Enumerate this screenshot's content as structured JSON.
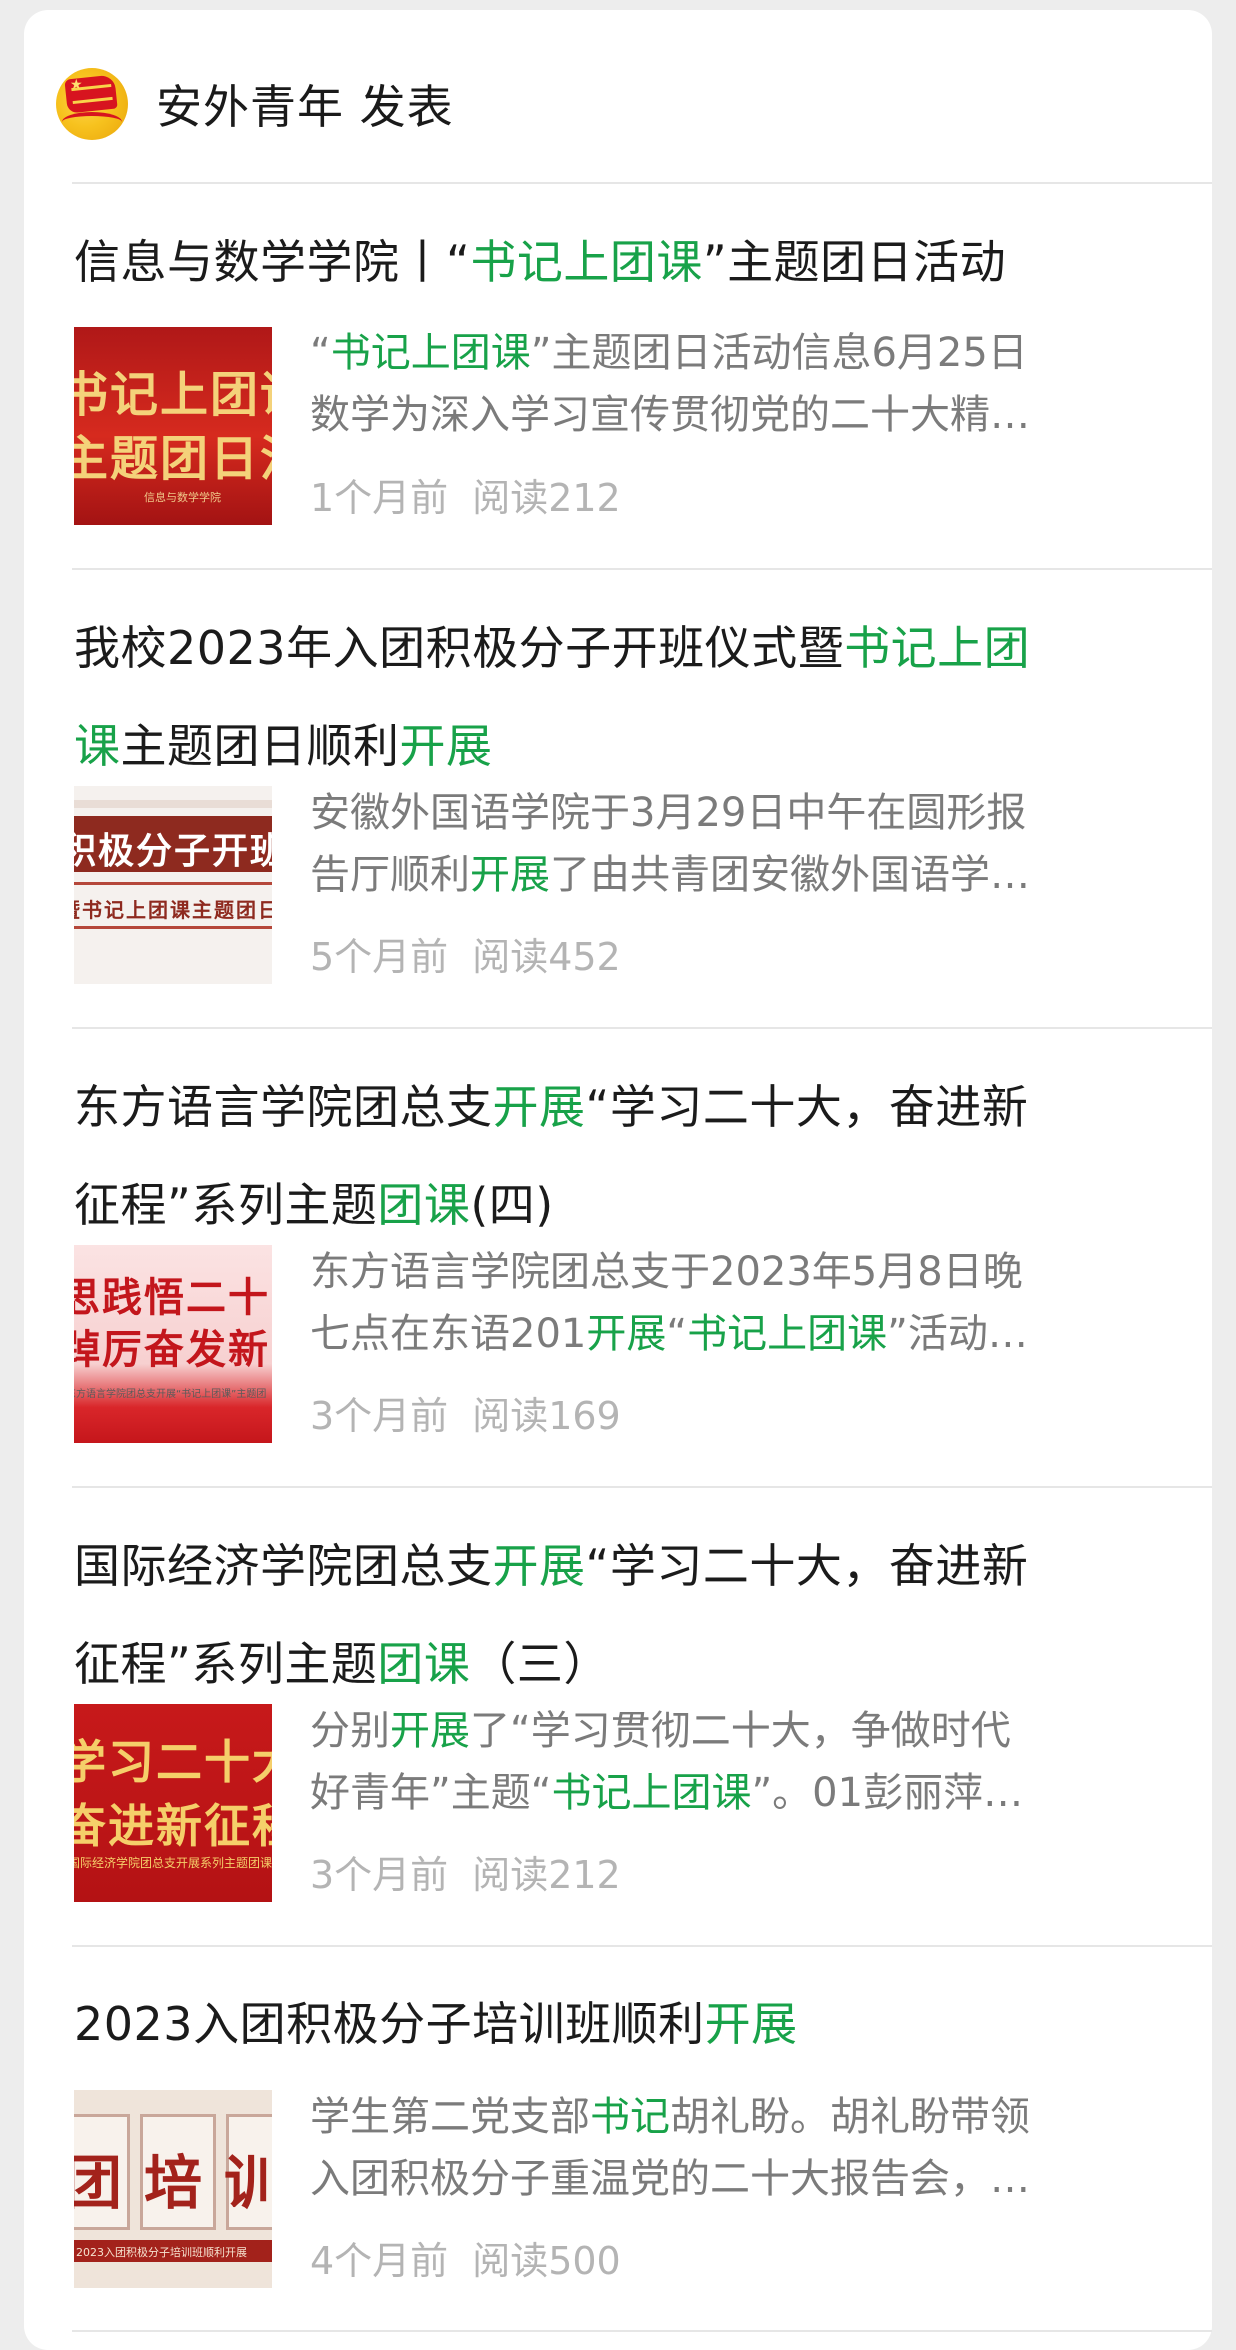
{
  "account": {
    "name": "安外青年 发表",
    "avatar_icon": "communist-youth-league-emblem-icon"
  },
  "colors": {
    "highlight": "#18a249",
    "title": "#1b1b1b",
    "summary": "#7b7b7b",
    "meta": "#b4b4b4"
  },
  "articles": [
    {
      "title_lines": [
        [
          {
            "t": "信息与数学学院丨“",
            "h": false
          },
          {
            "t": "书记上团课",
            "h": true
          },
          {
            "t": "”主题团日活动",
            "h": false
          }
        ]
      ],
      "summary_lines": [
        [
          {
            "t": "“",
            "h": false
          },
          {
            "t": "书记上团课",
            "h": true
          },
          {
            "t": "”主题团日活动信息6月25日",
            "h": false
          }
        ],
        [
          {
            "t": "数学为深入学习宣传贯彻党的二十大精…",
            "h": false
          }
        ]
      ],
      "time": "1个月前",
      "reads": "阅读212",
      "thumb": {
        "big1": "书记上团课",
        "big2": "主题团日活动",
        "small": "信息与数学学院",
        "icon": "article-thumbnail-red-banner"
      }
    },
    {
      "title_lines": [
        [
          {
            "t": "我校2023年入团积极分子开班仪式暨",
            "h": false
          },
          {
            "t": "书记上团",
            "h": true
          }
        ],
        [
          {
            "t": "课",
            "h": true
          },
          {
            "t": "主题团日顺利",
            "h": false
          },
          {
            "t": "开展",
            "h": true
          }
        ]
      ],
      "summary_lines": [
        [
          {
            "t": "安徽外国语学院于3月29日中午在圆形报",
            "h": false
          }
        ],
        [
          {
            "t": "告厅顺利",
            "h": false
          },
          {
            "t": "开展",
            "h": true
          },
          {
            "t": "了由共青团安徽外国语学…",
            "h": false
          }
        ]
      ],
      "time": "5个月前",
      "reads": "阅读452",
      "thumb": {
        "big1": "积极分子开班",
        "big2": "暨书记上团课主题团日",
        "small": "",
        "icon": "article-thumbnail-brown-banner"
      }
    },
    {
      "title_lines": [
        [
          {
            "t": "东方语言学院团总支",
            "h": false
          },
          {
            "t": "开展",
            "h": true
          },
          {
            "t": "“学习二十大，奋进新",
            "h": false
          }
        ],
        [
          {
            "t": "征程”系列主题",
            "h": false
          },
          {
            "t": "团课",
            "h": true
          },
          {
            "t": "(四)",
            "h": false
          }
        ]
      ],
      "summary_lines": [
        [
          {
            "t": "东方语言学院团总支于2023年5月8日晚",
            "h": false
          }
        ],
        [
          {
            "t": "七点在东语201",
            "h": false
          },
          {
            "t": "开展",
            "h": true
          },
          {
            "t": "“",
            "h": false
          },
          {
            "t": "书记上团课",
            "h": true
          },
          {
            "t": "”活动…",
            "h": false
          }
        ]
      ],
      "time": "3个月前",
      "reads": "阅读169",
      "thumb": {
        "big1": "思践悟二十",
        "big2": "踔厉奋发新时",
        "small": "东方语言学院团总支开展“书记上团课”主题团",
        "icon": "article-thumbnail-pink-banner"
      }
    },
    {
      "title_lines": [
        [
          {
            "t": "国际经济学院团总支",
            "h": false
          },
          {
            "t": "开展",
            "h": true
          },
          {
            "t": "“学习二十大，奋进新",
            "h": false
          }
        ],
        [
          {
            "t": "征程”系列主题",
            "h": false
          },
          {
            "t": "团课",
            "h": true
          },
          {
            "t": "（三）",
            "h": false
          }
        ]
      ],
      "summary_lines": [
        [
          {
            "t": "分别",
            "h": false
          },
          {
            "t": "开展",
            "h": true
          },
          {
            "t": "了“学习贯彻二十大，争做时代",
            "h": false
          }
        ],
        [
          {
            "t": "好青年”主题“",
            "h": false
          },
          {
            "t": "书记上团课",
            "h": true
          },
          {
            "t": "”。01彭丽萍…",
            "h": false
          }
        ]
      ],
      "time": "3个月前",
      "reads": "阅读212",
      "thumb": {
        "big1": "学习二十大",
        "big2": "奋进新征程",
        "small": "国际经济学院团总支开展系列主题团课",
        "icon": "article-thumbnail-gold-on-red-banner"
      }
    },
    {
      "title_lines": [
        [
          {
            "t": "2023入团积极分子培训班顺利",
            "h": false
          },
          {
            "t": "开展",
            "h": true
          }
        ]
      ],
      "summary_lines": [
        [
          {
            "t": "学生第二党支部",
            "h": false
          },
          {
            "t": "书记",
            "h": true
          },
          {
            "t": "胡礼盼。胡礼盼带领",
            "h": false
          }
        ],
        [
          {
            "t": "入团积极分子重温党的二十大报告会，…",
            "h": false
          }
        ]
      ],
      "time": "4个月前",
      "reads": "阅读500",
      "thumb": {
        "big1": "团培训",
        "big2": "",
        "small": "2023入团积极分子培训班顺利开展",
        "icon": "article-thumbnail-cream-banner"
      }
    }
  ]
}
